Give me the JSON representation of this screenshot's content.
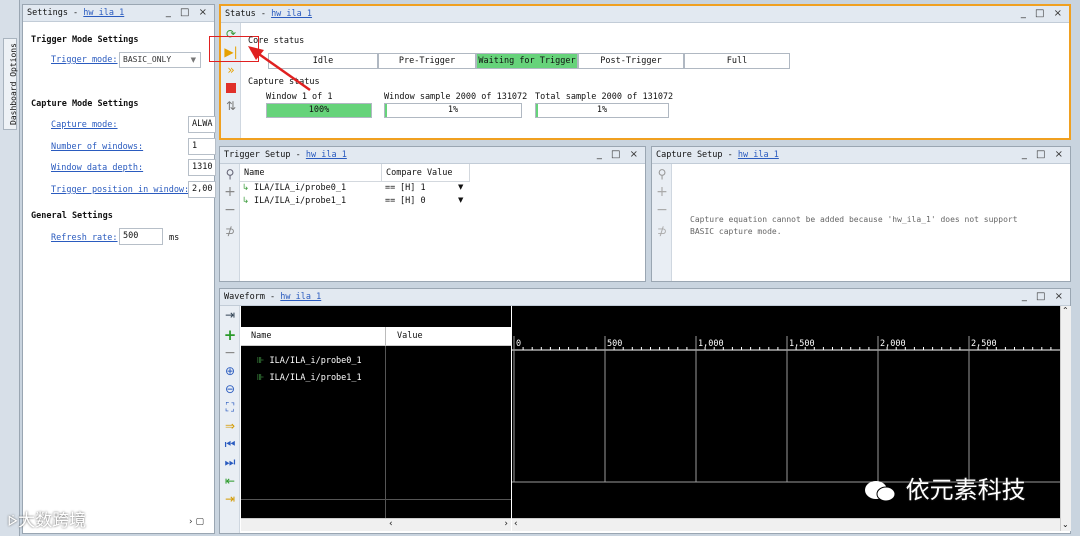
{
  "sidebar_tab": "Dashboard Options",
  "settings": {
    "title_prefix": "Settings - ",
    "title_link": "hw_ila_1",
    "trigger_mode_section": "Trigger Mode Settings",
    "trigger_mode_label": "Trigger mode:",
    "trigger_mode_value": "BASIC_ONLY",
    "capture_mode_section": "Capture Mode Settings",
    "capture_mode_label": "Capture mode:",
    "capture_mode_value": "ALWA",
    "num_windows_label": "Number of windows:",
    "num_windows_value": "1",
    "window_depth_label": "Window data depth:",
    "window_depth_value": "1310",
    "trigger_pos_label": "Trigger position in window:",
    "trigger_pos_value": "2,00",
    "general_section": "General Settings",
    "refresh_label": "Refresh rate:",
    "refresh_value": "500",
    "refresh_unit": "ms"
  },
  "status": {
    "title_prefix": "Status - ",
    "title_link": "hw_ila_1",
    "core_status_label": "Core status",
    "states": [
      "Idle",
      "Pre-Trigger",
      "Waiting for Trigger",
      "Post-Trigger",
      "Full"
    ],
    "active_state": "Waiting for Trigger",
    "capture_status_label": "Capture status",
    "window_label": "Window 1 of 1",
    "window_percent": "100%",
    "window_fill": 1.0,
    "window_sample_label": "Window sample 2000 of 131072",
    "window_sample_percent": "1%",
    "window_sample_fill": 0.015,
    "total_sample_label": "Total sample 2000 of 131072",
    "total_sample_percent": "1%",
    "total_sample_fill": 0.015
  },
  "trigger_setup": {
    "title_prefix": "Trigger Setup - ",
    "title_link": "hw_ila_1",
    "col_name": "Name",
    "col_compare": "Compare Value",
    "rows": [
      {
        "name": "ILA/ILA_i/probe0_1",
        "op": "==",
        "value": "[H] 1"
      },
      {
        "name": "ILA/ILA_i/probe1_1",
        "op": "==",
        "value": "[H] 0"
      }
    ]
  },
  "capture_setup": {
    "title_prefix": "Capture Setup - ",
    "title_link": "hw_ila_1",
    "message_line1": "Capture equation cannot be added because 'hw_ila_1' does not support",
    "message_line2": "BASIC capture mode."
  },
  "waveform": {
    "title_prefix": "Waveform - ",
    "title_link": "hw_ila_1",
    "col_name": "Name",
    "col_value": "Value",
    "signals": [
      "ILA/ILA_i/probe0_1",
      "ILA/ILA_i/probe1_1"
    ],
    "ticks": [
      "0",
      "500",
      "1,000",
      "1,500",
      "2,000",
      "2,500"
    ]
  },
  "window_controls": "_ □ ×",
  "watermark_left": "大数跨境",
  "watermark_right": "依元素科技",
  "colors": {
    "status_active": "#66d37a",
    "status_border": "#f0a020",
    "link": "#2a5bbf",
    "callout": "#e02020"
  }
}
